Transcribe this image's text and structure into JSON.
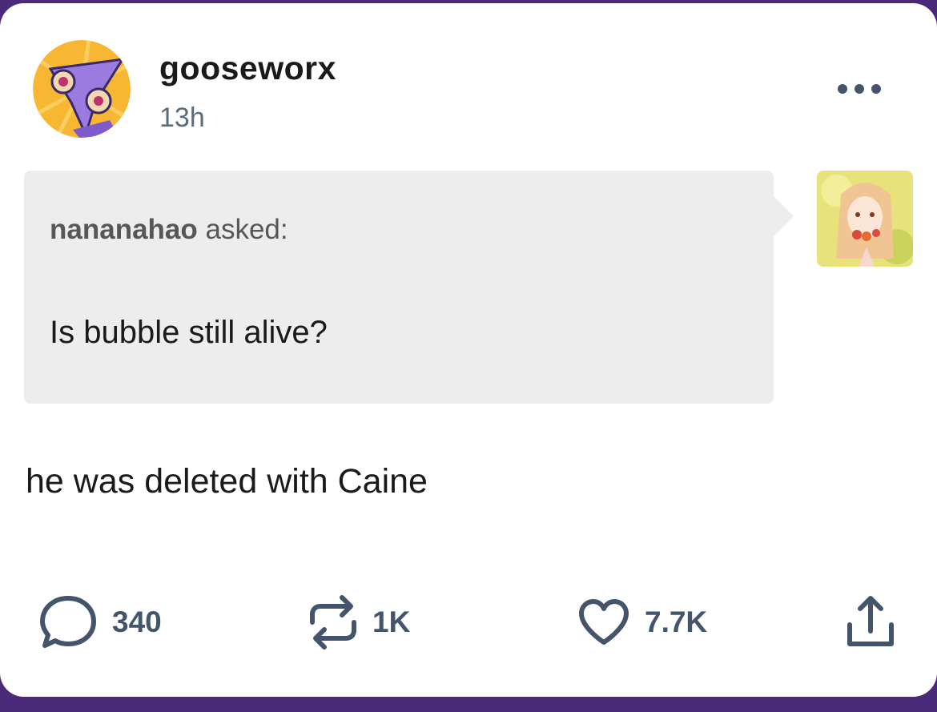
{
  "post": {
    "author": "gooseworx",
    "time": "13h",
    "ask": {
      "asker": "nananahao",
      "asked_label": "asked:",
      "question": "Is bubble still alive?"
    },
    "answer": "he was deleted with Caine"
  },
  "actions": {
    "comments": "340",
    "reblogs": "1K",
    "likes": "7.7K"
  },
  "colors": {
    "page_bg": "#4a2a78",
    "card_bg": "#ffffff",
    "ask_bg": "#ededed",
    "icon": "#44546a",
    "timestamp": "#5a6b7c"
  },
  "icons": [
    "more-options-icon",
    "comment-icon",
    "reblog-icon",
    "heart-icon",
    "share-icon"
  ]
}
